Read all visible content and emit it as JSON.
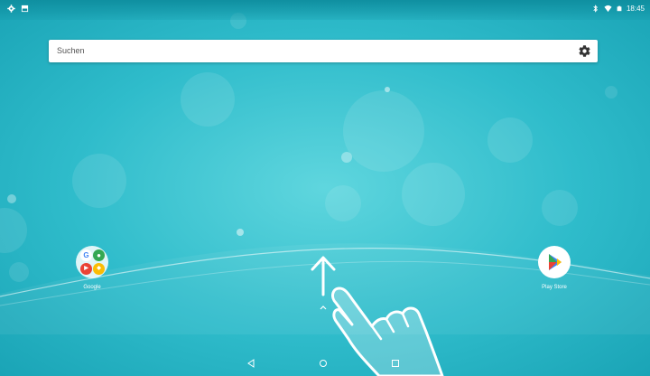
{
  "status_bar": {
    "left_icons": [
      "settings-icon",
      "photo-icon"
    ],
    "right_icons": [
      "bluetooth-icon",
      "wifi-icon",
      "battery-icon"
    ],
    "time": "18:45"
  },
  "search": {
    "placeholder": "Suchen",
    "gear_icon": "settings-gear-icon"
  },
  "apps": [
    {
      "label": "Google",
      "icon": "google-folder-icon"
    },
    {
      "label": "Play Store",
      "icon": "play-store-icon"
    }
  ],
  "gesture_hint": {
    "arrow_icon": "swipe-up-arrow-icon",
    "caret_icon": "chevron-up-icon",
    "hand_icon": "hand-pointer-icon"
  },
  "nav_bar": {
    "back_icon": "back-triangle-icon",
    "home_icon": "home-circle-icon",
    "recents_icon": "recents-square-icon"
  },
  "colors": {
    "wallpaper": "#2fbccb",
    "status_bar": "#0f8fa0",
    "google_red": "#ea4335",
    "google_blue": "#4285f4",
    "google_green": "#34a853",
    "google_yellow": "#fbbc05"
  }
}
